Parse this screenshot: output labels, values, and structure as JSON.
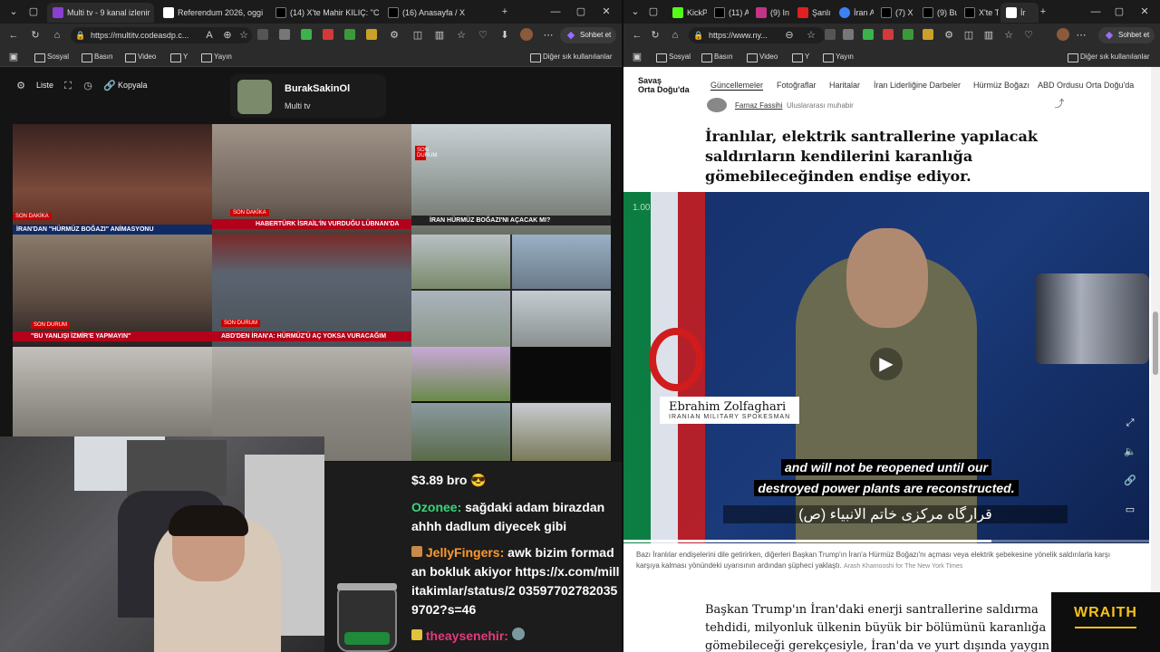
{
  "left_browser": {
    "tabs": [
      {
        "label": "Multi tv - 9 kanal izlenir",
        "active": true,
        "color": "#8a3fd1"
      },
      {
        "label": "Referendum 2026, oggi",
        "active": false,
        "color": "#ffffff"
      },
      {
        "label": "(14) X'te Mahir KILIÇ: \"C",
        "active": false,
        "color": "#000000"
      },
      {
        "label": "(16) Anasayfa / X",
        "active": false,
        "color": "#000000"
      }
    ],
    "url": "https://multitv.codeasdp.c...",
    "copilot_label": "Sohbet et",
    "bookmarks": [
      "Sosyal",
      "Basın",
      "Video",
      "Y",
      "Yayın"
    ],
    "other_bookmarks": "Diğer sık kullanılanlar"
  },
  "right_browser": {
    "tabs": [
      {
        "label": "KickPc",
        "color": "#53fc18"
      },
      {
        "label": "(11) A",
        "color": "#000000"
      },
      {
        "label": "(9) In",
        "color": "#c13584"
      },
      {
        "label": "Şanlı",
        "color": "#e02020"
      },
      {
        "label": "İran A",
        "color": "#3b82f6"
      },
      {
        "label": "(7) X F",
        "color": "#000000"
      },
      {
        "label": "(9) Bu",
        "color": "#000000"
      },
      {
        "label": "X'te Tı",
        "color": "#000000"
      },
      {
        "label": "İr",
        "color": "#ffffff",
        "active": true
      }
    ],
    "url": "https://www.ny...",
    "copilot_label": "Sohbet et",
    "bookmarks": [
      "Sosyal",
      "Basın",
      "Video",
      "Y",
      "Yayın"
    ],
    "other_bookmarks": "Diğer sık kullanılanlar"
  },
  "multitv": {
    "toolbar": {
      "list_label": "Liste",
      "copy_label": "Kopyala"
    },
    "profile": {
      "name": "BurakSakinOl",
      "subtitle": "Multi tv"
    },
    "tiles": [
      {
        "id": "tile-1",
        "caption": "İRAN'DAN \"HÜRMÜZ BOĞAZI\" ANİMASYONU",
        "tag": "SON DAKİKA",
        "bg": "#7a4a3a"
      },
      {
        "id": "tile-2",
        "caption": "HABERTÜRK İSRAİL'İN VURDUĞU LÜBNAN'DA",
        "tag": "SON DAKİKA",
        "bg": "#8a7c74"
      },
      {
        "id": "tile-3",
        "caption": "İRAN HÜRMÜZ BOĞAZI'NI AÇACAK MI?",
        "tag": "SON DURUM",
        "bg": "#9aa3a0"
      },
      {
        "id": "tile-4",
        "caption": "\"BU YANLIŞI İZMİR'E YAPMAYIN\"",
        "tag": "SON DURUM",
        "bg": "#6d5a50"
      },
      {
        "id": "tile-5",
        "caption": "ABD'DEN İRAN'A: HÜRMÜZ'Ü AÇ YOKSA VURACAĞIM",
        "tag": "SON DURUM",
        "bg": "#5a6470"
      },
      {
        "id": "tile-6",
        "caption": "",
        "tag": "",
        "bg": "#8e9aa6"
      },
      {
        "id": "tile-7",
        "caption": "",
        "tag": "",
        "bg": "#a7a3a0"
      },
      {
        "id": "tile-8",
        "caption": "",
        "tag": "",
        "bg": "#8c8a82"
      },
      {
        "id": "tile-9",
        "caption": "",
        "tag": "",
        "bg": "#7d8a6a"
      }
    ]
  },
  "stream_chat": {
    "messages": [
      {
        "user": "",
        "text": "$3.89 bro 😎",
        "user_color": "#ffffff"
      },
      {
        "user": "Ozonee:",
        "text": "sağdaki adam birazdan ahhh dadlum diyecek gibi",
        "user_color": "#37d67a"
      },
      {
        "user": "JellyFingers:",
        "text": "awk bizim formadan bokluk akiyor https://x.com/millitakimlar/status/2 035977027820359702?s=46",
        "user_color": "#ff9a2e"
      },
      {
        "user": "theaysenehir:",
        "text": "",
        "user_color": "#e23b7a"
      }
    ]
  },
  "nyt": {
    "section": {
      "line1": "Savaş",
      "line2": "Orta Doğu'da"
    },
    "nav": [
      "Güncellemeler",
      "Fotoğraflar",
      "Haritalar",
      "İran Liderliğine Darbeler",
      "Hürmüz Boğazı",
      "ABD Ordusu Orta Doğu'da"
    ],
    "author": {
      "name": "Farnaz Fassihi",
      "role": "Uluslararası muhabir"
    },
    "headline": "İranlılar, elektrik santrallerine yapılacak saldırıların kendilerini karanlığa gömebileceğinden endişe ediyor.",
    "video": {
      "speed": "1.00",
      "name": "Ebrahim Zolfaghari",
      "title": "IRANIAN MILITARY SPOKESMAN",
      "subtitle_line1": "and will not be reopened until our",
      "subtitle_line2": "destroyed power plants are reconstructed.",
      "arabic_caption": "قرارگاه مرکزی خاتم الانبیاء (ص)",
      "progress": 0.7
    },
    "caption": "Bazı İranlılar endişelerini dile getirirken, diğerleri Başkan Trump'ın İran'a Hürmüz Boğazı'nı açması veya elektrik şebekesine yönelik saldırılarla karşı karşıya kalması yönündeki uyarısının ardından şüpheci yaklaştı.",
    "credit": "Arash Khamooshi for The New York Times",
    "body": "Başkan Trump'ın İran'daki enerji santrallerine saldırma tehdidi, milyonluk ülkenin büyük bir bölümünü karanlığa gömebileceği gerekçesiyle, İran'da ve yurt dışında yaygın bir korku ve endişe"
  },
  "overlay": {
    "brand": "WRAITH"
  },
  "colors": {
    "chat_bg": "#1c1c1c",
    "accent": "#3b82f6",
    "nyt_text": "#121212"
  }
}
